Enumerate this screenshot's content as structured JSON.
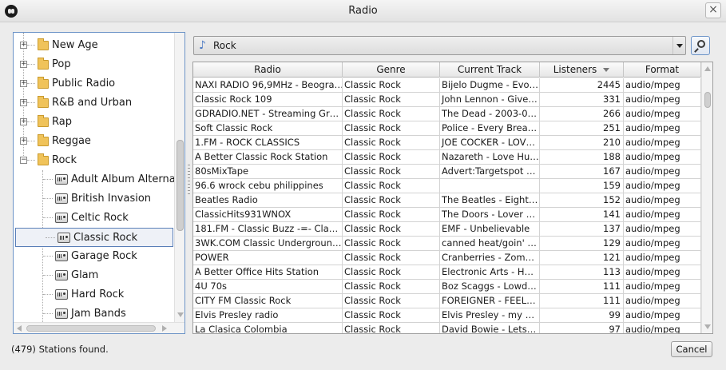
{
  "window": {
    "title": "Radio",
    "close_glyph": "×"
  },
  "tree": {
    "categories": [
      {
        "label": "New Age",
        "expander": "+"
      },
      {
        "label": "Pop",
        "expander": "+"
      },
      {
        "label": "Public Radio",
        "expander": "+"
      },
      {
        "label": "R&B and Urban",
        "expander": "+"
      },
      {
        "label": "Rap",
        "expander": "+"
      },
      {
        "label": "Reggae",
        "expander": "+"
      },
      {
        "label": "Rock",
        "expander": "−"
      }
    ],
    "rock_children": [
      {
        "label": "Adult Album Alternat"
      },
      {
        "label": "British Invasion"
      },
      {
        "label": "Celtic Rock"
      },
      {
        "label": "Classic Rock",
        "selected": true
      },
      {
        "label": "Garage Rock"
      },
      {
        "label": "Glam"
      },
      {
        "label": "Hard Rock"
      },
      {
        "label": "Jam Bands"
      }
    ]
  },
  "genre_select": {
    "value": "Rock",
    "icon": "music-note-icon"
  },
  "table": {
    "columns": [
      "Radio",
      "Genre",
      "Current Track",
      "Listeners",
      "Format"
    ],
    "sort_column": "Listeners",
    "rows": [
      [
        "NAXI RADIO 96,9MHz - Beogra…",
        "Classic Rock",
        "Bijelo Dugme - Evo…",
        "2445",
        "audio/mpeg"
      ],
      [
        "Classic Rock 109",
        "Classic Rock",
        "John Lennon - Give…",
        "331",
        "audio/mpeg"
      ],
      [
        "GDRADIO.NET - Streaming Gr…",
        "Classic Rock",
        "The Dead - 2003-0…",
        "266",
        "audio/mpeg"
      ],
      [
        "Soft Classic Rock",
        "Classic Rock",
        "Police - Every Brea…",
        "251",
        "audio/mpeg"
      ],
      [
        "1.FM - ROCK CLASSICS",
        "Classic Rock",
        "JOE COCKER - LOV…",
        "210",
        "audio/mpeg"
      ],
      [
        "A Better Classic Rock Station",
        "Classic Rock",
        "Nazareth - Love Hu…",
        "188",
        "audio/mpeg"
      ],
      [
        "80sMixTape",
        "Classic Rock",
        "Advert:Targetspot …",
        "167",
        "audio/mpeg"
      ],
      [
        "96.6 wrock cebu philippines",
        "Classic Rock",
        "",
        "159",
        "audio/mpeg"
      ],
      [
        "Beatles Radio",
        "Classic Rock",
        "The Beatles - Eight…",
        "152",
        "audio/mpeg"
      ],
      [
        "ClassicHits931WNOX",
        "Classic Rock",
        "The Doors - Lover …",
        "141",
        "audio/mpeg"
      ],
      [
        "181.FM - Classic Buzz -=- Cla…",
        "Classic Rock",
        "EMF - Unbelievable",
        "137",
        "audio/mpeg"
      ],
      [
        "3WK.COM Classic Undergroun…",
        "Classic Rock",
        "canned heat/goin' …",
        "129",
        "audio/mpeg"
      ],
      [
        "POWER",
        "Classic Rock",
        "Cranberries - Zom…",
        "121",
        "audio/mpeg"
      ],
      [
        "A Better Office Hits Station",
        "Classic Rock",
        "Electronic Arts - H…",
        "113",
        "audio/mpeg"
      ],
      [
        "4U 70s",
        "Classic Rock",
        "Boz Scaggs - Lowd…",
        "111",
        "audio/mpeg"
      ],
      [
        "CITY FM Classic Rock",
        "Classic Rock",
        "FOREIGNER - FEEL…",
        "111",
        "audio/mpeg"
      ],
      [
        "Elvis Presley radio",
        "Classic Rock",
        "Elvis Presley - my …",
        "99",
        "audio/mpeg"
      ],
      [
        "La Clasica Colombia",
        "Classic Rock",
        "David Bowie - Lets…",
        "97",
        "audio/mpeg"
      ]
    ]
  },
  "status_text": "(479) Stations found.",
  "cancel_label": "Cancel",
  "colors": {
    "selection_border": "#5a7fb8",
    "focus_border": "#6d94c7",
    "folder": "#f0c35a"
  }
}
